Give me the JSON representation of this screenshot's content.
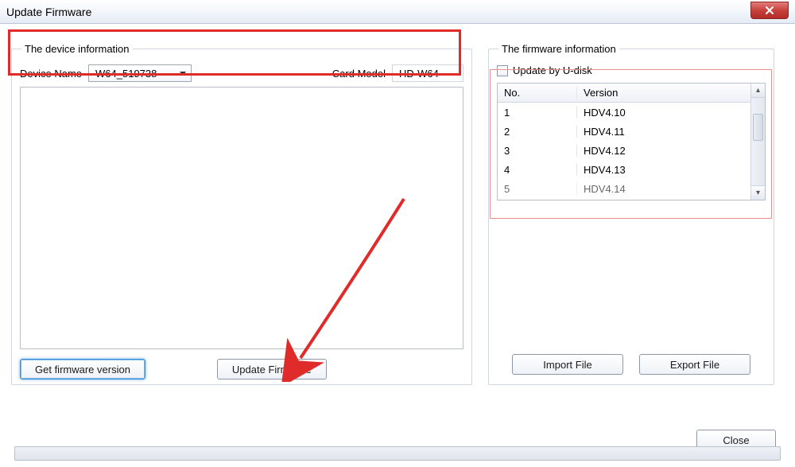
{
  "window": {
    "title": "Update Firmware"
  },
  "left": {
    "group_title": "The device information",
    "device_name_label": "Device Name",
    "device_name_value": "W64_519738",
    "card_model_label": "Card Model",
    "card_model_value": "HD-W64",
    "get_version_label": "Get firmware version",
    "update_label": "Update Firmware"
  },
  "right": {
    "group_title": "The firmware information",
    "udisk_label": "Update by U-disk",
    "udisk_checked": false,
    "col_no": "No.",
    "col_version": "Version",
    "rows": [
      {
        "no": "1",
        "version": "HDV4.10"
      },
      {
        "no": "2",
        "version": "HDV4.11"
      },
      {
        "no": "3",
        "version": "HDV4.12"
      },
      {
        "no": "4",
        "version": "HDV4.13"
      },
      {
        "no": "5",
        "version": "HDV4.14"
      }
    ],
    "import_label": "Import File",
    "export_label": "Export File"
  },
  "footer": {
    "close_label": "Close"
  }
}
